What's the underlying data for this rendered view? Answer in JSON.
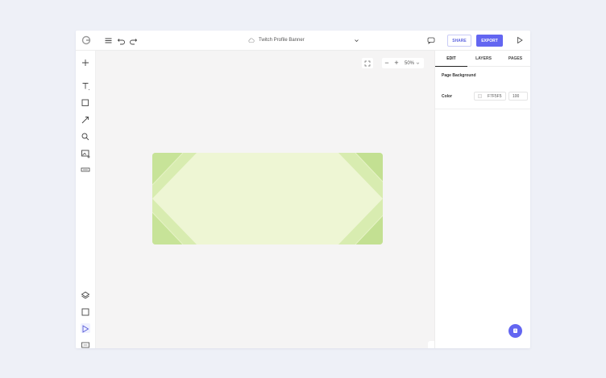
{
  "header": {
    "doc_title": "Twitch Profile Banner",
    "share_label": "SHARE",
    "export_label": "EXPORT",
    "icons": [
      "logo-icon",
      "menu-icon",
      "undo-icon",
      "redo-icon",
      "cloud-icon",
      "chevron-down-icon",
      "comment-icon",
      "play-icon"
    ]
  },
  "toolbar": {
    "zoom_value": "50%",
    "zoom_minus": "−",
    "zoom_plus": "+"
  },
  "left_tools": [
    "add",
    "text",
    "shape",
    "line",
    "search-graphics",
    "image",
    "keyboard",
    "layers",
    "frame",
    "select",
    "media",
    "move"
  ],
  "right_panel": {
    "tabs": [
      "EDIT",
      "LAYERS",
      "PAGES"
    ],
    "active_tab": "EDIT",
    "section_title": "Page Background",
    "color_label": "Color",
    "color_value": "F7F5F5",
    "opacity_value": "100"
  },
  "colors": {
    "accent": "#6366f1",
    "canvas_bg": "#f7f5f5",
    "banner_light": "#eef6d4",
    "banner_dark": "#c2e08f"
  }
}
